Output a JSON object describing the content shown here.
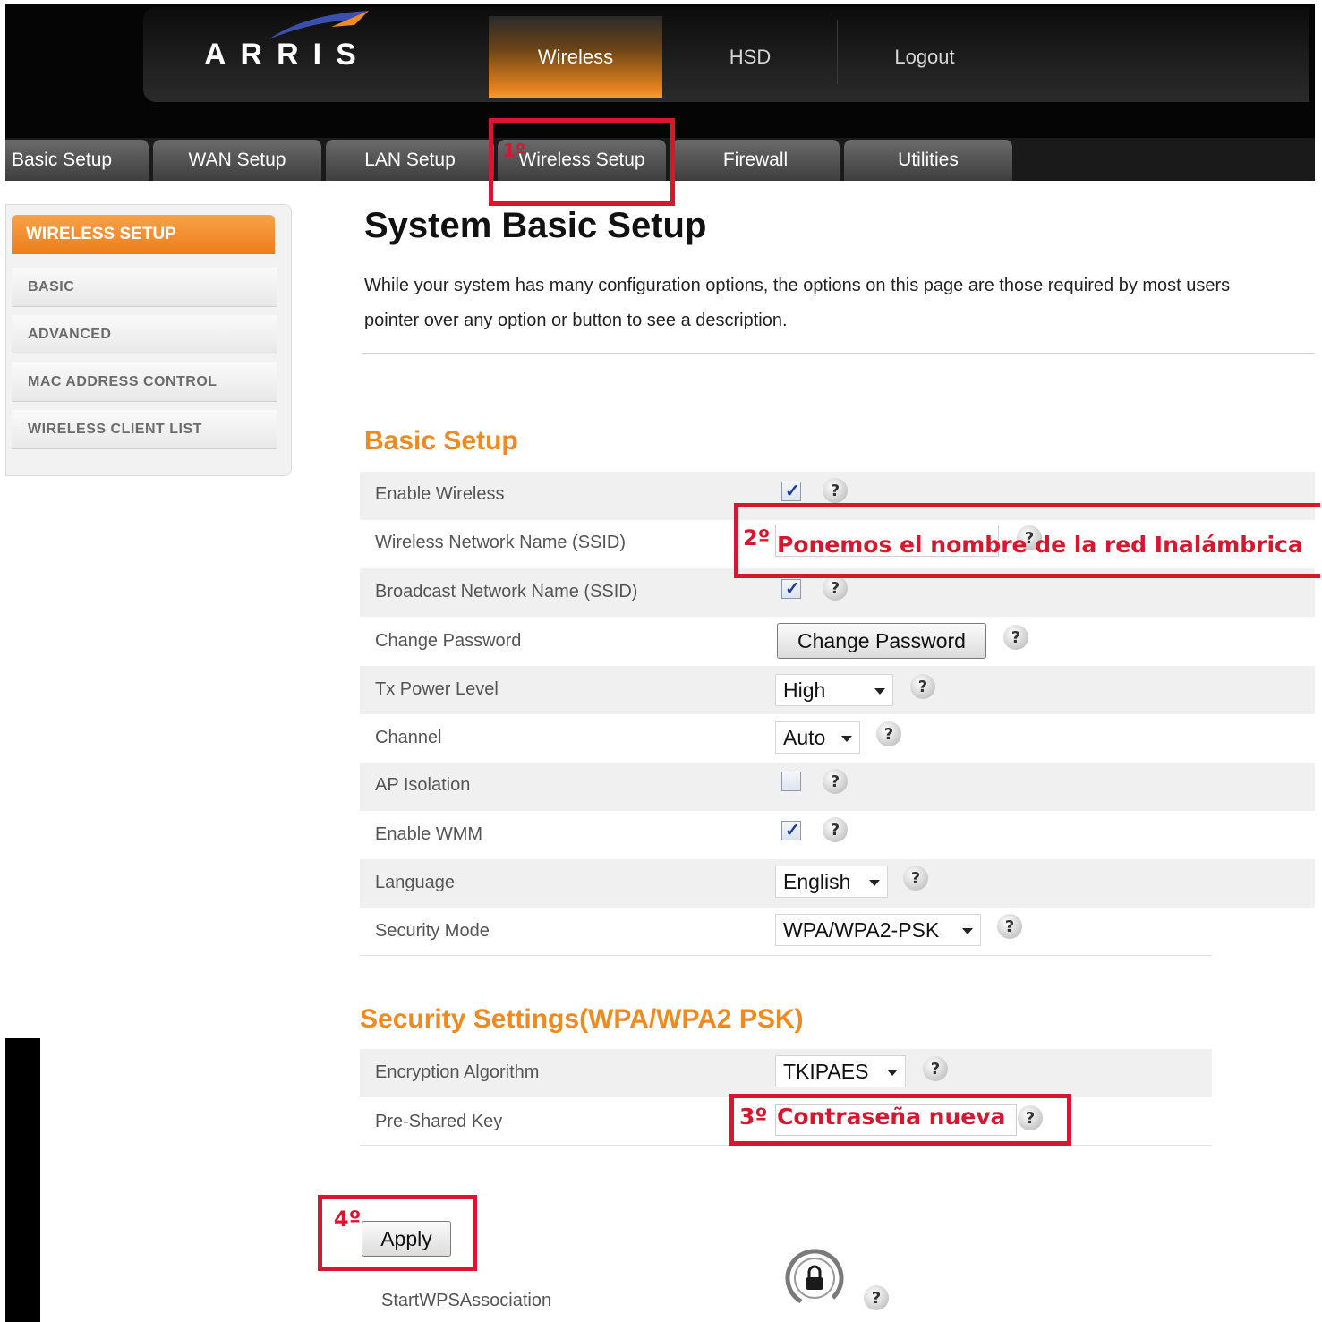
{
  "header": {
    "logo": "ARRIS",
    "tabs": [
      {
        "label": "Wireless",
        "active": true
      },
      {
        "label": "HSD",
        "active": false
      },
      {
        "label": "Logout",
        "active": false
      }
    ]
  },
  "subnav": {
    "tabs": [
      {
        "label": "Basic Setup"
      },
      {
        "label": "WAN Setup"
      },
      {
        "label": "LAN Setup"
      },
      {
        "label": "Wireless Setup",
        "active": true
      },
      {
        "label": "Firewall"
      },
      {
        "label": "Utilities"
      }
    ]
  },
  "sidebar": {
    "heading": "WIRELESS SETUP",
    "items": [
      {
        "label": "BASIC"
      },
      {
        "label": "ADVANCED"
      },
      {
        "label": "MAC ADDRESS CONTROL"
      },
      {
        "label": "WIRELESS CLIENT LIST"
      }
    ]
  },
  "main": {
    "title": "System Basic Setup",
    "description_line1": "While your system has many configuration options, the options on this page are those required by most users",
    "description_line2": "pointer over any option or button to see a description.",
    "basic_section": "Basic Setup",
    "rows": {
      "enable_wireless": {
        "label": "Enable Wireless",
        "checked": true
      },
      "ssid": {
        "label": "Wireless Network Name (SSID)"
      },
      "broadcast_ssid": {
        "label": "Broadcast Network Name (SSID)",
        "checked": true
      },
      "change_password": {
        "label": "Change Password",
        "button": "Change Password"
      },
      "tx_power": {
        "label": "Tx Power Level",
        "value": "High"
      },
      "channel": {
        "label": "Channel",
        "value": "Auto"
      },
      "ap_isolation": {
        "label": "AP Isolation",
        "checked": false
      },
      "enable_wmm": {
        "label": "Enable WMM",
        "checked": true
      },
      "language": {
        "label": "Language",
        "value": "English"
      },
      "security_mode": {
        "label": "Security Mode",
        "value": "WPA/WPA2-PSK"
      }
    },
    "security_section": "Security Settings(WPA/WPA2 PSK)",
    "security_rows": {
      "encryption": {
        "label": "Encryption Algorithm",
        "value": "TKIPAES"
      },
      "psk": {
        "label": "Pre-Shared Key"
      }
    },
    "apply_button": "Apply",
    "wps_label": "StartWPSAssociation",
    "help_glyph": "?"
  },
  "annotations": {
    "step1": "1º",
    "step2_num": "2º",
    "step2_text": "Ponemos el nombre de la red Inalámbrica",
    "step3_num": "3º",
    "step3_text": "Contraseña nueva",
    "step4": "4º",
    "color": "#d7172f"
  },
  "colors": {
    "accent_orange": "#ef8a20",
    "header_black": "#050505"
  }
}
